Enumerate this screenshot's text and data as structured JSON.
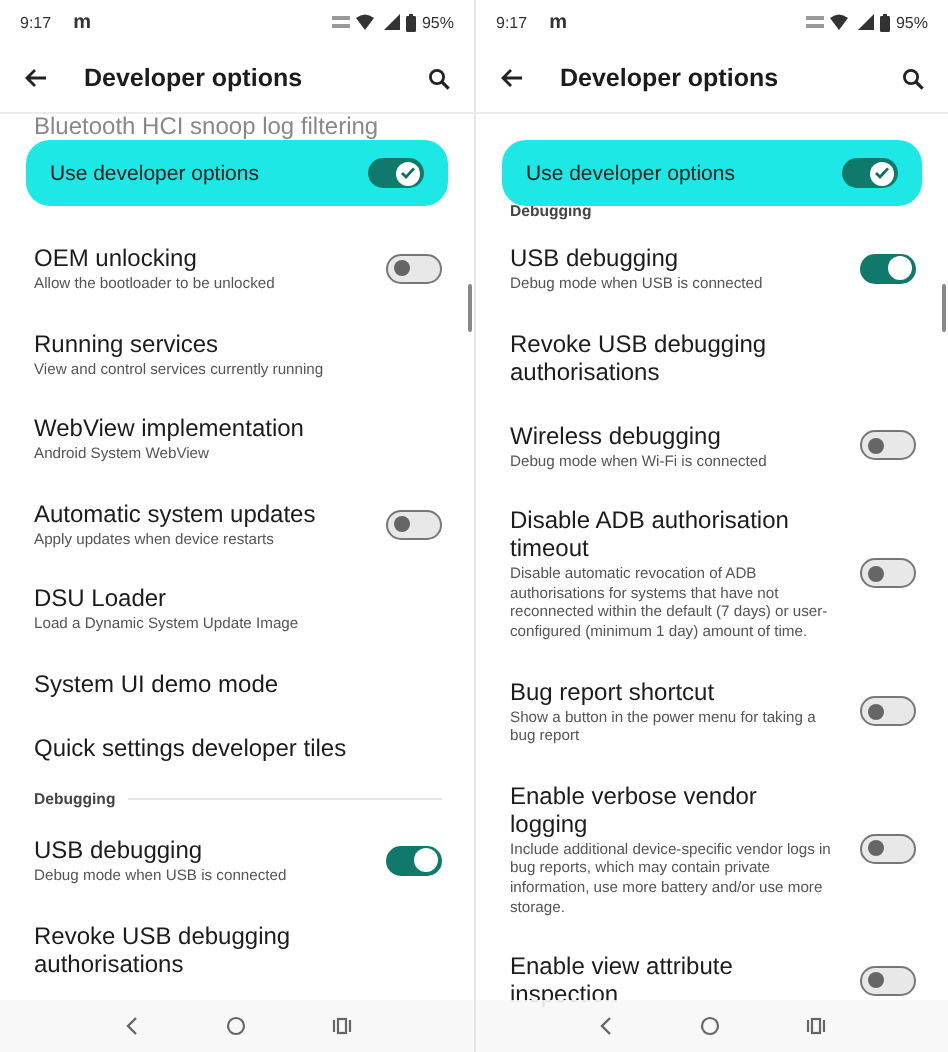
{
  "screens": [
    {
      "status_bar": {
        "time": "9:17",
        "app_letter": "m",
        "battery": "95%"
      },
      "title": "Developer options",
      "master": {
        "label": "Use developer options",
        "on": true
      },
      "peek": {
        "kind": "item",
        "text": "Bluetooth HCI snoop log filtering"
      },
      "items": [
        {
          "kind": "toggle",
          "title": "OEM unlocking",
          "subtitle": "Allow the bootloader to be unlocked",
          "on": false
        },
        {
          "kind": "item",
          "title": "Running services",
          "subtitle": "View and control services currently running"
        },
        {
          "kind": "item",
          "title": "WebView implementation",
          "subtitle": "Android System WebView"
        },
        {
          "kind": "toggle",
          "title": "Automatic system updates",
          "subtitle": "Apply updates when device restarts",
          "on": false
        },
        {
          "kind": "item",
          "title": "DSU Loader",
          "subtitle": "Load a Dynamic System Update Image"
        },
        {
          "kind": "item",
          "title": "System UI demo mode"
        },
        {
          "kind": "item",
          "title": "Quick settings developer tiles"
        },
        {
          "kind": "header",
          "title": "Debugging"
        },
        {
          "kind": "toggle",
          "title": "USB debugging",
          "subtitle": "Debug mode when USB is connected",
          "on": true
        },
        {
          "kind": "item",
          "title": "Revoke USB debugging authorisations"
        }
      ]
    },
    {
      "status_bar": {
        "time": "9:17",
        "app_letter": "m",
        "battery": "95%"
      },
      "title": "Developer options",
      "master": {
        "label": "Use developer options",
        "on": true
      },
      "peek": {
        "kind": "header",
        "text": "Debugging"
      },
      "items": [
        {
          "kind": "toggle",
          "title": "USB debugging",
          "subtitle": "Debug mode when USB is connected",
          "on": true
        },
        {
          "kind": "item",
          "title": "Revoke USB debugging authorisations"
        },
        {
          "kind": "toggle",
          "title": "Wireless debugging",
          "subtitle": "Debug mode when Wi-Fi is connected",
          "on": false
        },
        {
          "kind": "toggle",
          "title": "Disable ADB authorisation timeout",
          "subtitle": "Disable automatic revocation of ADB authorisations for systems that have not reconnected within the default (7 days) or user-configured (minimum 1 day) amount of time.",
          "on": false
        },
        {
          "kind": "toggle",
          "title": "Bug report shortcut",
          "subtitle": "Show a button in the power menu for taking a bug report",
          "on": false
        },
        {
          "kind": "toggle",
          "title": "Enable verbose vendor logging",
          "subtitle": "Include additional device-specific vendor logs in bug reports, which may contain private information, use more battery and/or use more storage.",
          "on": false
        },
        {
          "kind": "toggle",
          "title": "Enable view attribute inspection",
          "on": false
        }
      ]
    }
  ]
}
